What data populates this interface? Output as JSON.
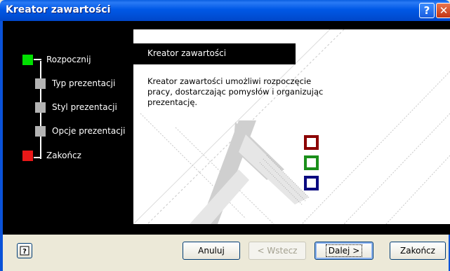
{
  "window": {
    "title": "Kreator zawartości",
    "help_glyph": "?",
    "close_glyph": "✕"
  },
  "steps": [
    {
      "label": "Rozpocznij",
      "state": "current",
      "color": "#00e000"
    },
    {
      "label": "Typ prezentacji",
      "state": "pending",
      "color": "#b3b3b3"
    },
    {
      "label": "Styl prezentacji",
      "state": "pending",
      "color": "#b3b3b3"
    },
    {
      "label": "Opcje prezentacji",
      "state": "pending",
      "color": "#b3b3b3"
    },
    {
      "label": "Zakończ",
      "state": "final",
      "color": "#e81818"
    }
  ],
  "content": {
    "header": "Kreator zawartości",
    "description": "Kreator zawartości umożliwi rozpoczęcie pracy, dostarczając pomysłów i organizując prezentację."
  },
  "decor_boxes": [
    {
      "color": "#8b0000"
    },
    {
      "color": "#1a8f1a"
    },
    {
      "color": "#0a0a80"
    }
  ],
  "buttons": {
    "cancel": "Anuluj",
    "back": "< Wstecz",
    "next": "Dalej >",
    "finish": "Zakończ"
  }
}
